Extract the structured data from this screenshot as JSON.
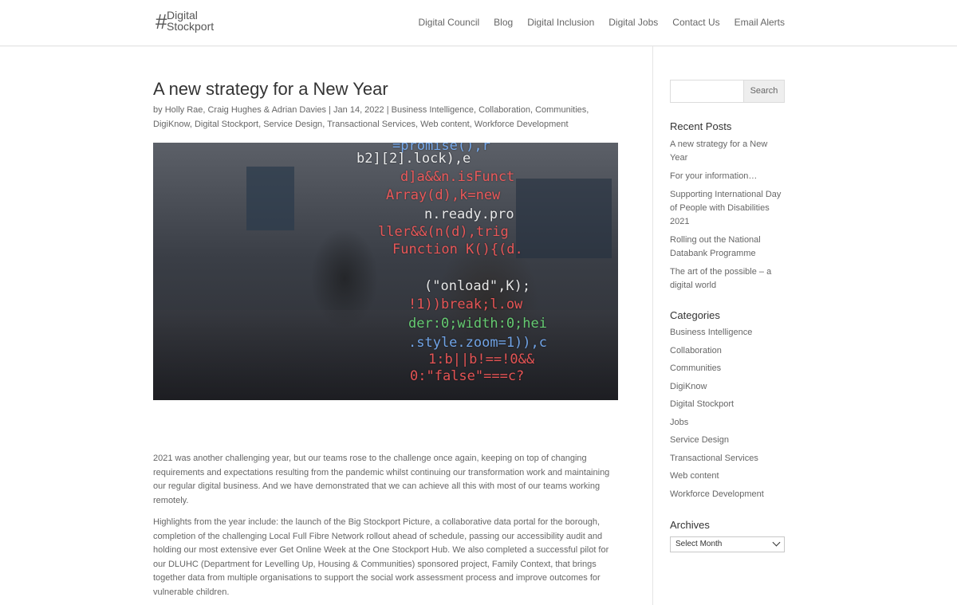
{
  "header": {
    "logo_hash": "#",
    "logo_line1": "Digital",
    "logo_line2": "Stockport",
    "nav": [
      "Digital Council",
      "Blog",
      "Digital Inclusion",
      "Digital Jobs",
      "Contact Us",
      "Email Alerts"
    ]
  },
  "post": {
    "title": "A new strategy for a New Year",
    "meta_prefix": "by ",
    "authors": "Holly Rae, Craig Hughes & Adrian Davies",
    "sep": " | ",
    "date": "Jan 14, 2022",
    "categories": [
      "Business Intelligence",
      "Collaboration",
      "Communities",
      "DigiKnow",
      "Digital Stockport",
      "Service Design",
      "Transactional Services",
      "Web content",
      "Workforce Development"
    ],
    "image_code_lines": [
      "=promise(),r",
      "b2][2].lock),e",
      "d]a&&n.isFunct",
      "Array(d),k=new",
      "n.ready.pro",
      "ller&&(n(d),trig",
      "Function K(){(d.",
      "(\"onload\",K);",
      "!1))break;l.ow",
      "der:0;width:0;hei",
      ".style.zoom=1)),c",
      "1:b||b!==!0&&",
      "0:\"false\"===c?"
    ],
    "paragraphs": [
      "2021 was another challenging year, but our teams rose to the challenge once again, keeping on top of changing requirements and expectations resulting from the pandemic whilst continuing our transformation work and maintaining our regular digital business. And we have demonstrated that we can achieve all this with most of our teams working remotely.",
      "Highlights from the year include: the launch of the Big Stockport Picture, a collaborative data portal for the borough, completion of the challenging Local Full Fibre Network rollout ahead of schedule, passing our accessibility audit and holding our most extensive ever Get Online Week at the One Stockport Hub. We also completed a successful pilot for our DLUHC (Department for Levelling Up, Housing & Communities) sponsored project, Family Context, that brings together data from multiple organisations to support the social work assessment process and improve outcomes for vulnerable children."
    ]
  },
  "sidebar": {
    "search_button": "Search",
    "search_value": "",
    "recent_title": "Recent Posts",
    "recent_posts": [
      "A new strategy for a New Year",
      "For your information…",
      "Supporting International Day of People with Disabilities 2021",
      "Rolling out the National Databank Programme",
      "The art of the possible – a digital world"
    ],
    "categories_title": "Categories",
    "categories": [
      "Business Intelligence",
      "Collaboration",
      "Communities",
      "DigiKnow",
      "Digital Stockport",
      "Jobs",
      "Service Design",
      "Transactional Services",
      "Web content",
      "Workforce Development"
    ],
    "archives_title": "Archives",
    "archives_select": "Select Month"
  },
  "colors": {
    "text": "#666666",
    "heading": "#333333",
    "border": "#e5e5e5"
  }
}
